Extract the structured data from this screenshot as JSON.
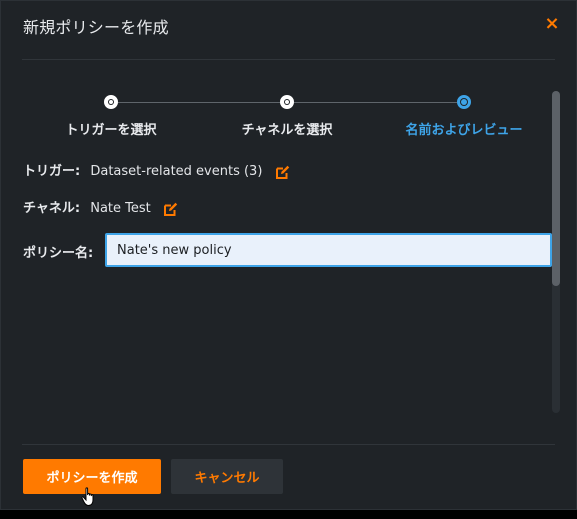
{
  "dialog": {
    "title": "新規ポリシーを作成",
    "close_icon": "close-icon",
    "close_glyph": "×"
  },
  "stepper": {
    "steps": [
      {
        "label": "トリガーを選択",
        "state": "done"
      },
      {
        "label": "チャネルを選択",
        "state": "done"
      },
      {
        "label": "名前およびレビュー",
        "state": "active"
      }
    ]
  },
  "summary": {
    "trigger_label": "トリガー:",
    "trigger_value": "Dataset-related events (3)",
    "channel_label": "チャネル:",
    "channel_value": "Nate Test",
    "edit_icon": "edit-icon"
  },
  "form": {
    "policy_name_label": "ポリシー名:",
    "policy_name_value": "Nate's new policy"
  },
  "footer": {
    "create_label": "ポリシーを作成",
    "cancel_label": "キャンセル"
  },
  "colors": {
    "accent": "#ff7a00",
    "active_step": "#3ea4e8",
    "background": "#1f2327"
  }
}
